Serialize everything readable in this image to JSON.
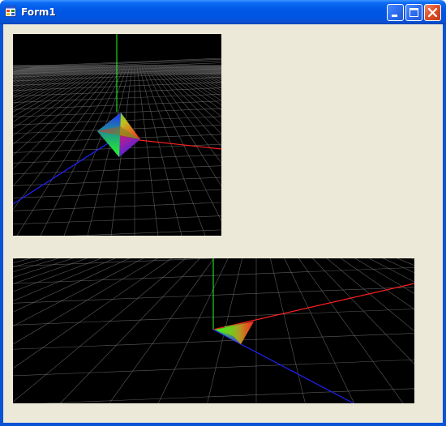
{
  "window": {
    "title": "Form1",
    "app_icon": "form-app-icon",
    "controls": [
      "minimize-icon",
      "maximize-icon",
      "close-icon"
    ],
    "titlebar_color": "#0055e3",
    "client_color": "#ece9d8"
  },
  "viewports": [
    {
      "id": "top",
      "content": "3d-scene-perspective",
      "background": "#000000"
    },
    {
      "id": "bottom",
      "content": "3d-scene-perspective",
      "background": "#000000"
    }
  ],
  "scene": {
    "axis_colors": {
      "x": "#ff2020",
      "y": "#20ff20",
      "z": "#2020ff"
    },
    "grid_color": "#7a7a7a",
    "object": "gradient-tetrahedron"
  }
}
